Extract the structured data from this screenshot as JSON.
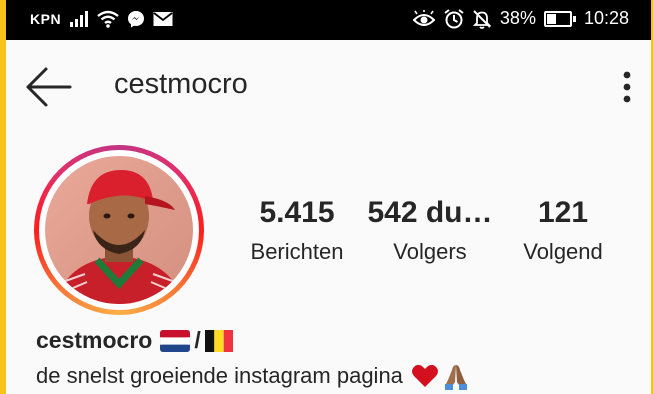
{
  "status_bar": {
    "carrier": "KPN",
    "battery": "38%",
    "time": "10:28",
    "icons_left": [
      "signal-icon",
      "wifi-icon",
      "messenger-icon",
      "mail-icon"
    ],
    "icons_right": [
      "eye-icon",
      "alarm-icon",
      "bell-off-icon",
      "battery-icon"
    ],
    "battery_level": 0.38
  },
  "header": {
    "username": "cestmocro",
    "back_icon": "back-arrow-icon",
    "menu_icon": "more-vertical-icon"
  },
  "profile": {
    "stats": [
      {
        "value": "5.415",
        "label": "Berichten"
      },
      {
        "value": "542 du…",
        "label": "Volgers"
      },
      {
        "value": "121",
        "label": "Volgend"
      }
    ],
    "name": "cestmocro",
    "name_separator": "/",
    "bio": "de snelst groeiende instagram pagina",
    "story_ring_colors": [
      "#c13584",
      "#e1306c",
      "#fd1d1d",
      "#f77737",
      "#fcaf45"
    ]
  }
}
